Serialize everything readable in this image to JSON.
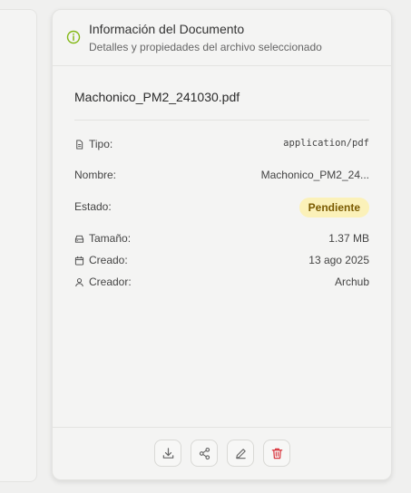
{
  "header": {
    "title": "Información del Documento",
    "subtitle": "Detalles y propiedades del archivo seleccionado",
    "icon": "info-icon"
  },
  "file": {
    "name": "Machonico_PM2_241030.pdf"
  },
  "details": {
    "type_label": "Tipo:",
    "type_value": "application/pdf",
    "name_label": "Nombre:",
    "name_value": "Machonico_PM2_24...",
    "status_label": "Estado:",
    "status_value": "Pendiente",
    "size_label": "Tamaño:",
    "size_value": "1.37 MB",
    "created_label": "Creado:",
    "created_value": "13 ago 2025",
    "creator_label": "Creador:",
    "creator_value": "Archub"
  },
  "actions": [
    {
      "name": "download",
      "icon": "download-icon"
    },
    {
      "name": "share",
      "icon": "share-icon"
    },
    {
      "name": "edit",
      "icon": "pencil-icon"
    },
    {
      "name": "delete",
      "icon": "trash-icon"
    }
  ],
  "colors": {
    "accent_green": "#84b817",
    "badge_bg": "#fbf1b9",
    "badge_text": "#7a5a00",
    "delete_red": "#d9363e"
  }
}
